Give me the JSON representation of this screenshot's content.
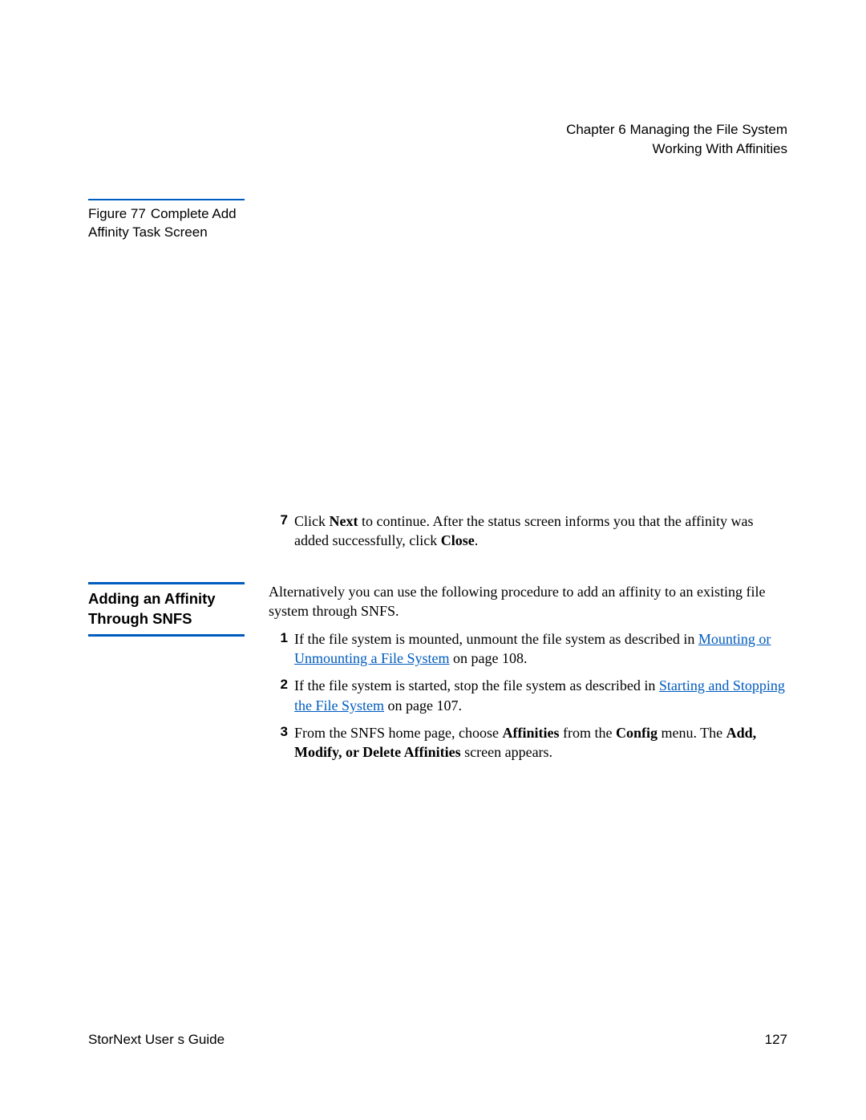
{
  "header": {
    "line1": "Chapter 6  Managing the File System",
    "line2": "Working With Affinities"
  },
  "figure": {
    "label": "Figure 77",
    "title": "Complete Add Affinity Task Screen"
  },
  "step7": {
    "num": "7",
    "pre": "Click ",
    "b1": "Next",
    "mid": " to continue. After the status screen informs you that the affinity was added successfully, click ",
    "b2": "Close",
    "post": "."
  },
  "section": {
    "heading_line1": "Adding an Affinity",
    "heading_line2": "Through SNFS",
    "intro": "Alternatively you can use the following procedure to add an affinity to an existing file system through SNFS."
  },
  "steps": [
    {
      "num": "1",
      "pre": "If the file system is mounted, unmount the file system as described in ",
      "link": "Mounting or Unmounting a File System",
      "post_link": " on page  108."
    },
    {
      "num": "2",
      "pre": "If the file system is started, stop the file system as described in ",
      "link": "Starting and Stopping the File System",
      "post_link": " on page  107."
    },
    {
      "num": "3",
      "p1": "From the SNFS home page, choose ",
      "b1": "Affinities",
      "p2": " from the ",
      "b2": "Config",
      "p3": " menu. The ",
      "b3": "Add, Modify, or Delete Affinities",
      "p4": " screen appears."
    }
  ],
  "footer": {
    "left": "StorNext User s Guide",
    "right": "127"
  }
}
